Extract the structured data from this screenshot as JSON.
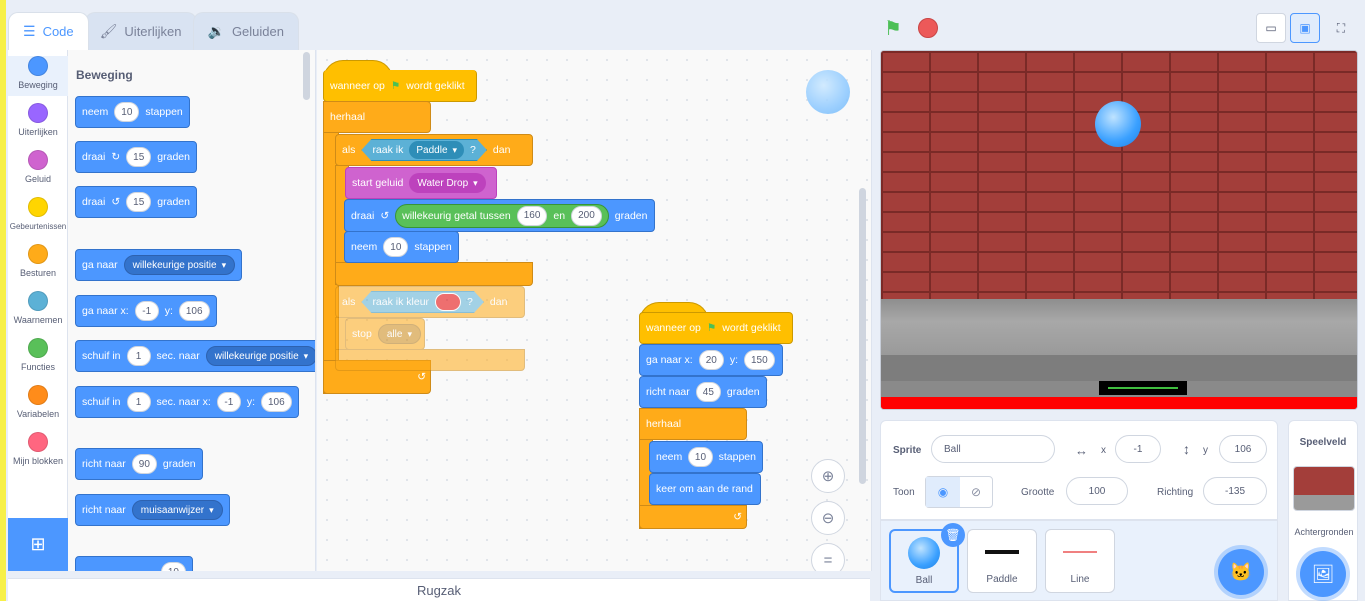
{
  "tabs": [
    {
      "label": "Code"
    },
    {
      "label": "Uiterlijken"
    },
    {
      "label": "Geluiden"
    }
  ],
  "categories": [
    {
      "label": "Beweging",
      "color": "#4c97ff"
    },
    {
      "label": "Uiterlijken",
      "color": "#9966ff"
    },
    {
      "label": "Geluid",
      "color": "#cf63cf"
    },
    {
      "label": "Gebeurtenissen",
      "color": "#ffd500"
    },
    {
      "label": "Besturen",
      "color": "#ffab19"
    },
    {
      "label": "Waarnemen",
      "color": "#5cb1d6"
    },
    {
      "label": "Functies",
      "color": "#59c059"
    },
    {
      "label": "Variabelen",
      "color": "#ff8c1a"
    },
    {
      "label": "Mijn blokken",
      "color": "#ff6680"
    }
  ],
  "palette": {
    "title": "Beweging",
    "neem": "neem",
    "neem_val": "10",
    "stappen": "stappen",
    "draai": "draai",
    "draai_r_val": "15",
    "graden": "graden",
    "draai_l_val": "15",
    "ganaar": "ga naar",
    "ganaar_dd": "willekeurige positie",
    "ganaarxy": "ga naar x:",
    "gx": "-1",
    "y": "y:",
    "gy": "106",
    "schuif": "schuif in",
    "schuif_val": "1",
    "sec_naar": "sec. naar",
    "schuif_dd": "willekeurige positie",
    "schuif2_val": "1",
    "sec_naar_x": "sec. naar x:",
    "sx": "-1",
    "sy": "106",
    "richt": "richt naar",
    "richt_val": "90",
    "richt2_dd": "muisaanwijzer",
    "partial": "10"
  },
  "script1": {
    "hat1": "wanneer op",
    "hat2": "wordt geklikt",
    "herhaal": "herhaal",
    "als": "als",
    "raak": "raak ik",
    "paddle": "Paddle",
    "q": "?",
    "dan": "dan",
    "startgeluid": "start geluid",
    "waterdrop": "Water Drop",
    "draai": "draai",
    "willekeurig": "willekeurig getal tussen",
    "v160": "160",
    "en": "en",
    "v200": "200",
    "graden": "graden",
    "neem": "neem",
    "n10": "10",
    "stappen": "stappen",
    "als2": "als",
    "raakkleur": "raak ik kleur",
    "q2": "?",
    "dan2": "dan",
    "stop": "stop",
    "alle": "alle"
  },
  "script2": {
    "hat1": "wanneer op",
    "hat2": "wordt geklikt",
    "ganaarx": "ga naar x:",
    "x": "20",
    "y": "y:",
    "yv": "150",
    "richt": "richt naar",
    "rv": "45",
    "graden": "graden",
    "herhaal": "herhaal",
    "neem": "neem",
    "n": "10",
    "stappen": "stappen",
    "keer": "keer om aan de rand"
  },
  "backpack": "Rugzak",
  "sprite_info": {
    "sprite_label": "Sprite",
    "sprite_name": "Ball",
    "x_label": "x",
    "x_val": "-1",
    "y_label": "y",
    "y_val": "106",
    "show_label": "Toon",
    "size_label": "Grootte",
    "size_val": "100",
    "dir_label": "Richting",
    "dir_val": "-135"
  },
  "sprites": [
    {
      "name": "Ball"
    },
    {
      "name": "Paddle"
    },
    {
      "name": "Line"
    }
  ],
  "stage_panel": {
    "title": "Speelveld",
    "backdrops": "Achtergronden"
  }
}
